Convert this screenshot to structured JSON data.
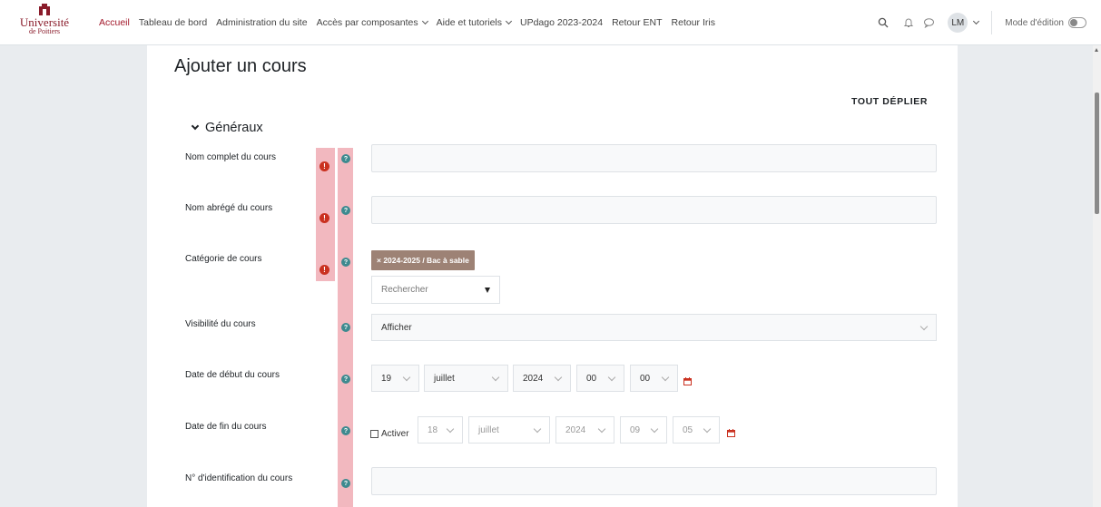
{
  "logo": {
    "main": "Université",
    "sub": "de Poitiers"
  },
  "nav": {
    "items": [
      {
        "label": "Accueil",
        "active": true,
        "dropdown": false
      },
      {
        "label": "Tableau de bord",
        "active": false,
        "dropdown": false
      },
      {
        "label": "Administration du site",
        "active": false,
        "dropdown": false
      },
      {
        "label": "Accès par composantes",
        "active": false,
        "dropdown": true
      },
      {
        "label": "Aide et tutoriels",
        "active": false,
        "dropdown": true
      },
      {
        "label": "UPdago 2023-2024",
        "active": false,
        "dropdown": false
      },
      {
        "label": "Retour ENT",
        "active": false,
        "dropdown": false
      },
      {
        "label": "Retour Iris",
        "active": false,
        "dropdown": false
      }
    ],
    "user_initials": "LM",
    "edit_mode_label": "Mode d'édition"
  },
  "page": {
    "title": "Ajouter un cours",
    "expand_all": "TOUT DÉPLIER",
    "section_title": "Généraux"
  },
  "form": {
    "fullname_label": "Nom complet du cours",
    "shortname_label": "Nom abrégé du cours",
    "category_label": "Catégorie de cours",
    "category_badge": "× 2024-2025 / Bac à sable",
    "category_search_placeholder": "Rechercher",
    "visibility_label": "Visibilité du cours",
    "visibility_value": "Afficher",
    "start_label": "Date de début du cours",
    "start": {
      "day": "19",
      "month": "juillet",
      "year": "2024",
      "hour": "00",
      "minute": "00"
    },
    "end_label": "Date de fin du cours",
    "end_enable_label": "Activer",
    "end": {
      "day": "18",
      "month": "juillet",
      "year": "2024",
      "hour": "09",
      "minute": "05"
    },
    "idnumber_label": "N° d'identification du cours"
  },
  "colors": {
    "accent": "#a3192b",
    "required": "#ca3120",
    "help": "#3d8a8f",
    "highlight": "#f2b8bf",
    "badge": "#9d8275"
  }
}
